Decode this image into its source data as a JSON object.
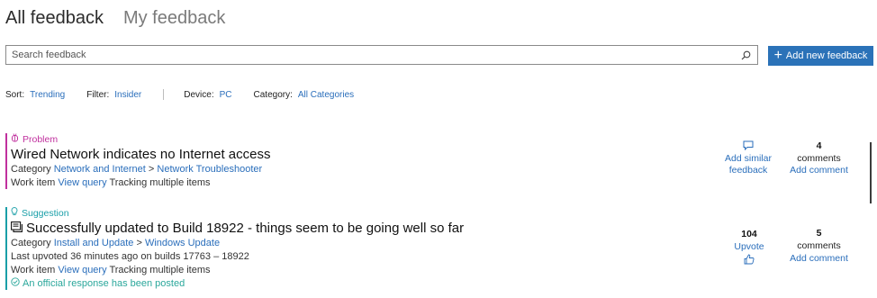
{
  "tabs": [
    {
      "label": "All feedback",
      "active": true
    },
    {
      "label": "My feedback",
      "active": false
    }
  ],
  "search": {
    "placeholder": "Search feedback",
    "icon": "search-icon"
  },
  "add_button": {
    "label": "Add new feedback",
    "icon": "plus-icon"
  },
  "filters": {
    "sort_label": "Sort:",
    "sort_value": "Trending",
    "filter_label": "Filter:",
    "filter_value": "Insider",
    "device_label": "Device:",
    "device_value": "PC",
    "category_label": "Category:",
    "category_value": "All Categories"
  },
  "items": [
    {
      "type_label": "Problem",
      "type_color": "#c0309e",
      "type_icon": "bug-icon",
      "title": "Wired Network indicates no Internet access",
      "category_label": "Category",
      "category": "Network and Internet",
      "category_sep": ">",
      "subcategory": "Network Troubleshooter",
      "work_item_label": "Work item",
      "view_query": "View query",
      "tracking": "Tracking multiple items",
      "action_label": "Add similar feedback",
      "action_icon": "add-similar-icon",
      "comments_count": "4",
      "comments_label": "comments",
      "add_comment": "Add comment"
    },
    {
      "type_label": "Suggestion",
      "type_color": "#1a9fa8",
      "type_icon": "lightbulb-icon",
      "title_icon": "announcement-icon",
      "title": "Successfully updated to Build 18922 - things seem to be going well so far",
      "category_label": "Category",
      "category": "Install and Update",
      "category_sep": ">",
      "subcategory": "Windows Update",
      "last_upvoted_label": "Last upvoted",
      "last_upvoted": "36 minutes ago on builds  17763 – 18922",
      "work_item_label": "Work item",
      "view_query": "View query",
      "tracking": "Tracking multiple items",
      "official_response": "An official response has been posted",
      "upvote_count": "104",
      "upvote_label": "Upvote",
      "upvote_icon": "thumbs-up-icon",
      "comments_count": "5",
      "comments_label": "comments",
      "add_comment": "Add comment"
    }
  ],
  "colors": {
    "accent": "#2b72b8",
    "problem": "#c0309e",
    "suggestion": "#1a9fa8",
    "official": "#2aa79b"
  }
}
